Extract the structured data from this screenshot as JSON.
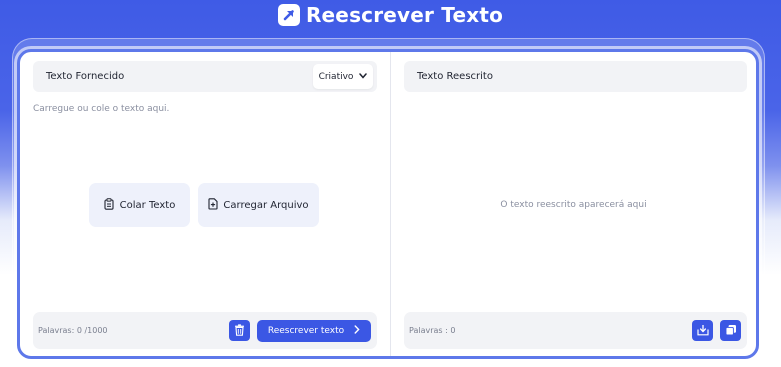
{
  "app": {
    "title": "Reescrever Texto",
    "logo_icon": "arrow-up-right-icon",
    "accent_color": "#3b57e4"
  },
  "input_panel": {
    "title": "Texto Fornecido",
    "mode_selected": "Criativo",
    "placeholder": "Carregue ou cole o texto aqui.",
    "paste_label": "Colar Texto",
    "upload_label": "Carregar Arquivo",
    "word_count": "Palavras: 0 /1000",
    "rewrite_label": "Reescrever texto",
    "delete_icon": "trash-icon"
  },
  "output_panel": {
    "title": "Texto Reescrito",
    "placeholder": "O texto reescrito aparecerá aqui",
    "word_count": "Palavras : 0",
    "download_icon": "download-icon",
    "copy_icon": "copy-icon"
  }
}
